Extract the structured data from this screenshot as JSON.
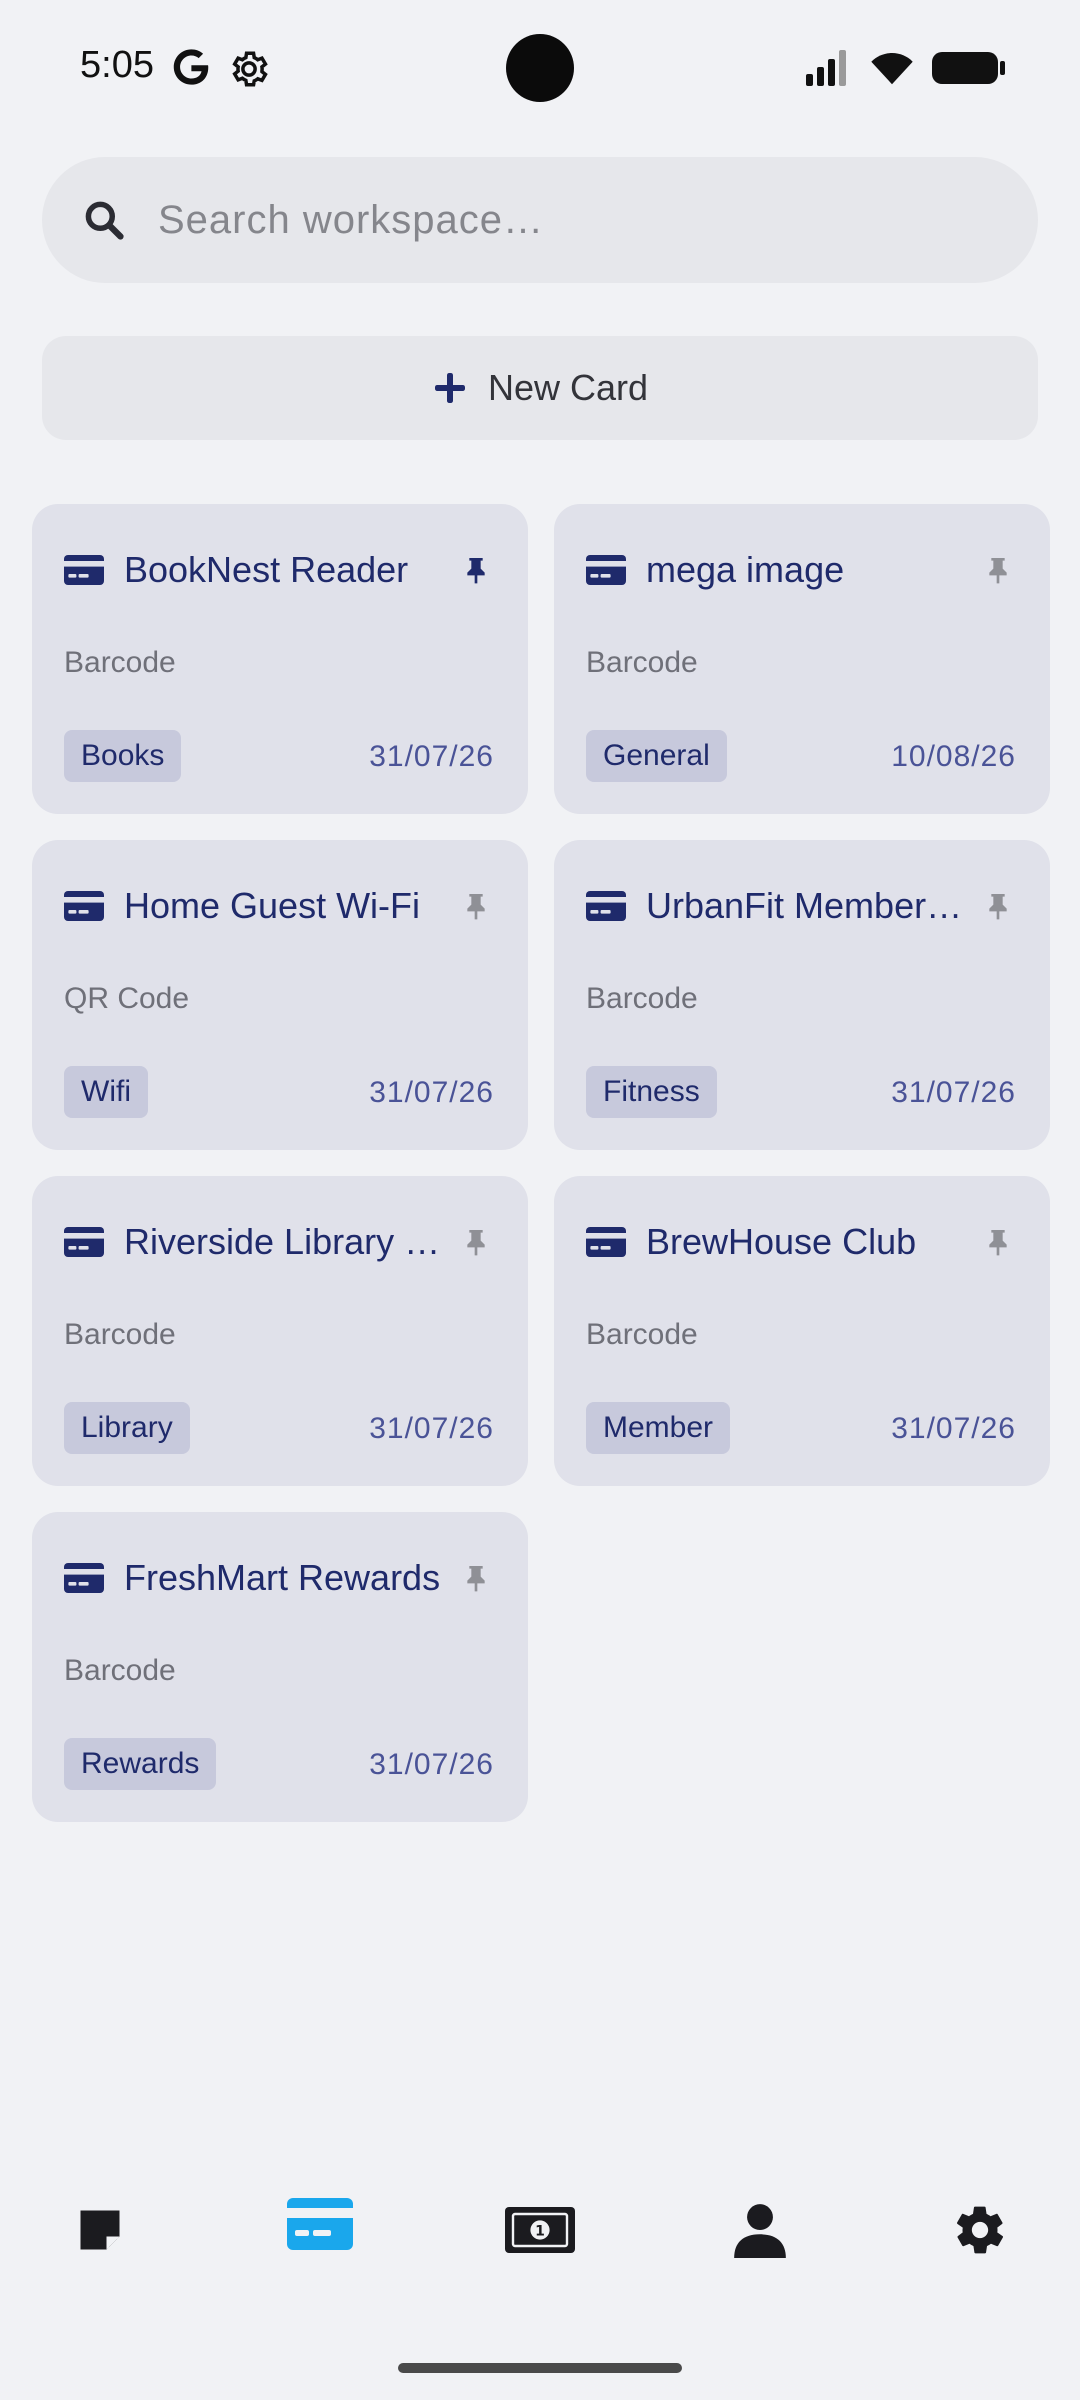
{
  "status_bar": {
    "time": "5:05"
  },
  "search": {
    "placeholder": "Search workspace…"
  },
  "new_card": {
    "label": "New Card"
  },
  "colors": {
    "accent": "#1f2a6b",
    "active_nav": "#1aa7ec",
    "pin_active": "#1f2a6b",
    "pin_inactive": "#8f9096"
  },
  "cards": [
    {
      "title": "BookNest Reader",
      "type": "Barcode",
      "tag": "Books",
      "date": "31/07/26",
      "pinned": true
    },
    {
      "title": "mega image",
      "type": "Barcode",
      "tag": "General",
      "date": "10/08/26",
      "pinned": false
    },
    {
      "title": "Home Guest Wi-Fi",
      "type": "QR Code",
      "tag": "Wifi",
      "date": "31/07/26",
      "pinned": false
    },
    {
      "title": "UrbanFit Membership",
      "type": "Barcode",
      "tag": "Fitness",
      "date": "31/07/26",
      "pinned": false
    },
    {
      "title": "Riverside Library Card",
      "type": "Barcode",
      "tag": "Library",
      "date": "31/07/26",
      "pinned": false
    },
    {
      "title": "BrewHouse Club",
      "type": "Barcode",
      "tag": "Member",
      "date": "31/07/26",
      "pinned": false
    },
    {
      "title": "FreshMart Rewards",
      "type": "Barcode",
      "tag": "Rewards",
      "date": "31/07/26",
      "pinned": false
    }
  ],
  "nav": [
    {
      "icon": "note-icon",
      "active": false
    },
    {
      "icon": "card-icon",
      "active": true
    },
    {
      "icon": "money-icon",
      "active": false
    },
    {
      "icon": "person-icon",
      "active": false
    },
    {
      "icon": "settings-icon",
      "active": false
    }
  ]
}
